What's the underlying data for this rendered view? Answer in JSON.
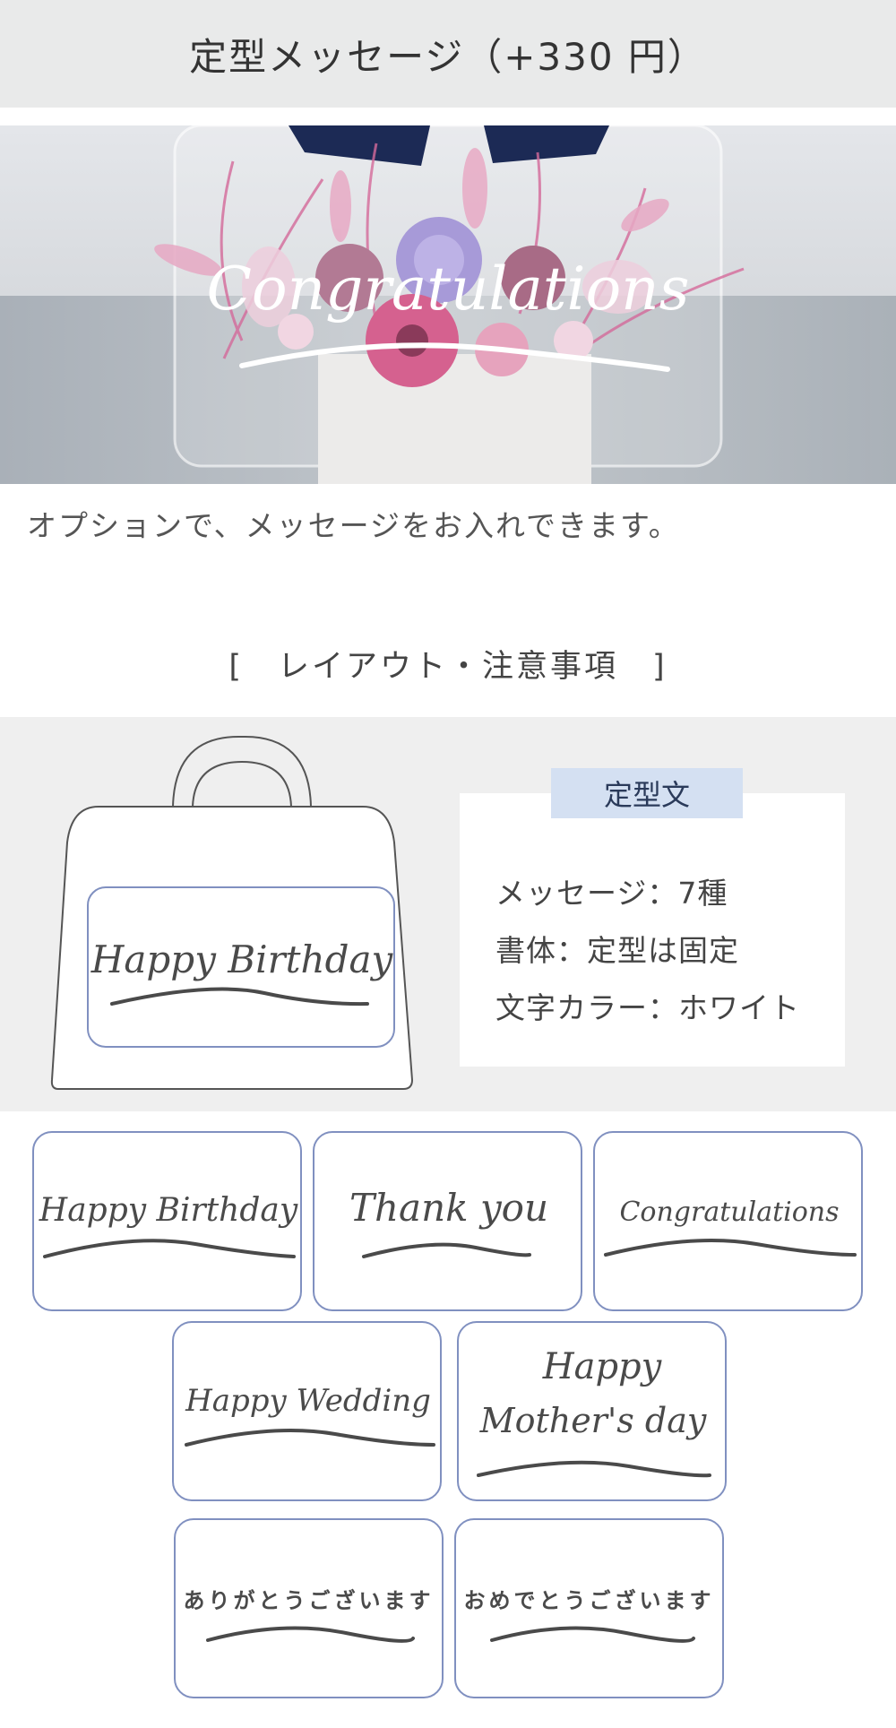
{
  "header": {
    "title": "定型メッセージ（+330 円）"
  },
  "hero": {
    "overlay_text": "Congratulations"
  },
  "intro": {
    "text": "オプションで、メッセージをお入れできます。"
  },
  "layout_section": {
    "heading_open": "[",
    "heading": "レイアウト・注意事項",
    "heading_close": "]",
    "bag_preview_text": "Happy Birthday",
    "info_tag": "定型文",
    "info_lines": [
      "メッセージ：7種",
      "書体：定型は固定",
      "文字カラー：ホワイト"
    ]
  },
  "samples": [
    {
      "text": "Happy Birthday"
    },
    {
      "text": "Thank you"
    },
    {
      "text": "Congratulations"
    },
    {
      "text": "Happy Wedding"
    },
    {
      "line1": "Happy",
      "line2": "Mother's day"
    },
    {
      "text": "ありがとうございます"
    },
    {
      "text": "おめでとうございます"
    }
  ],
  "colors": {
    "band": "#efefef",
    "tag": "#d4e0f2",
    "card_border": "#8090c0",
    "title_bar": "#e9eaea"
  }
}
